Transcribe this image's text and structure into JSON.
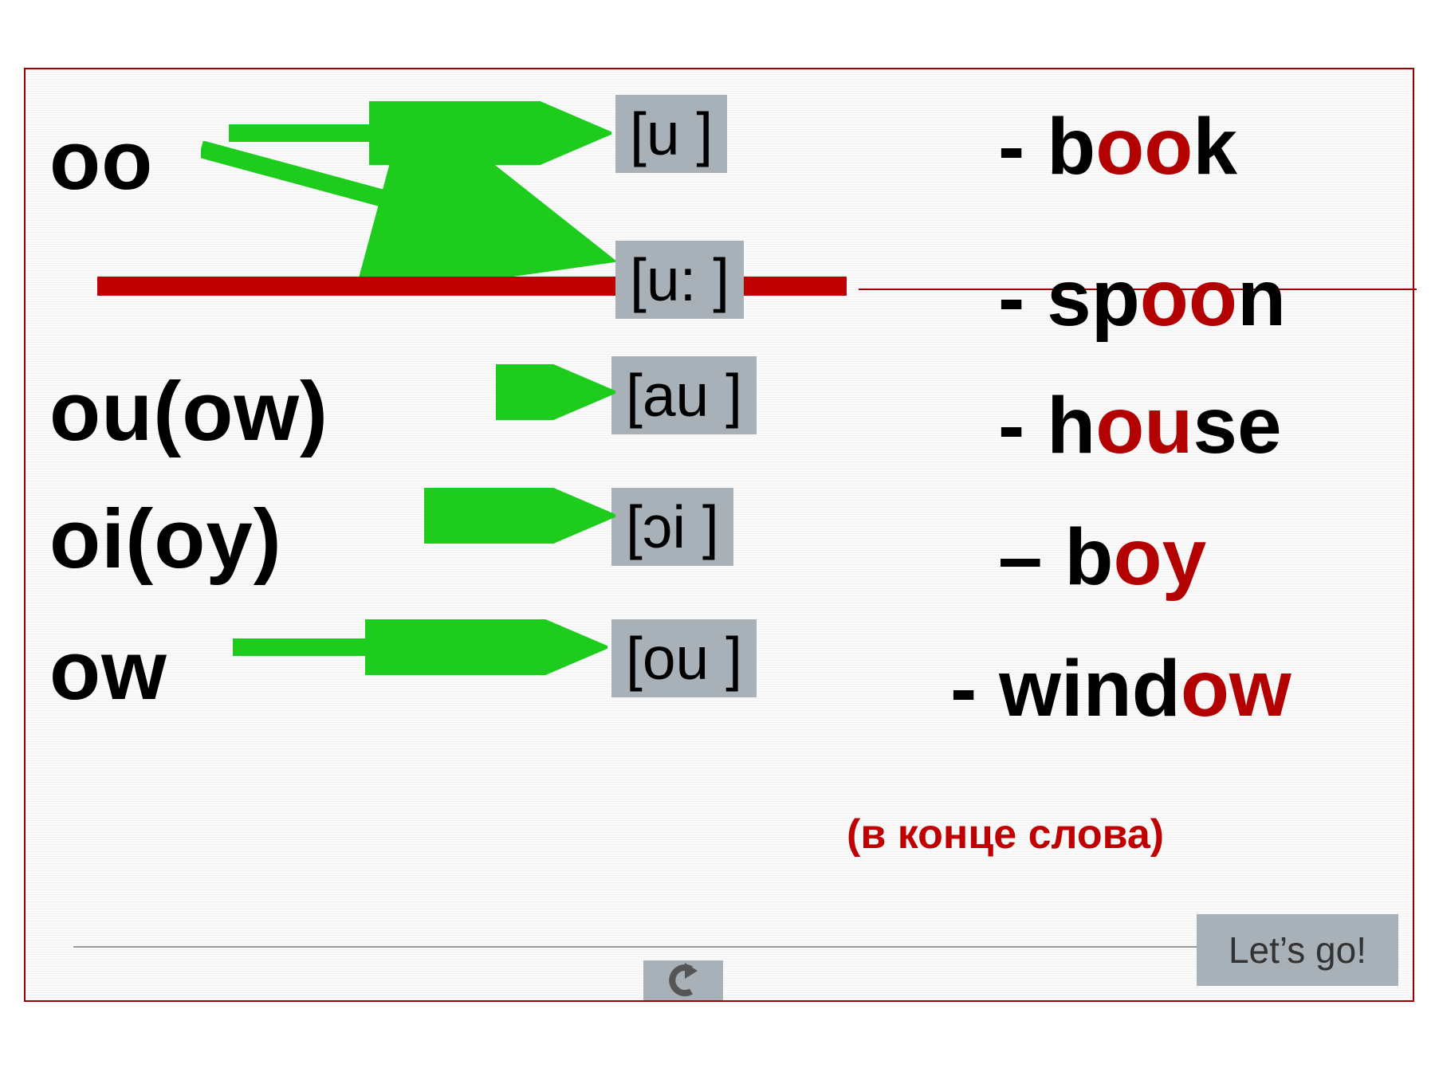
{
  "row1": {
    "letters": "oo",
    "phon_a": "[u ]",
    "phon_b": "[u: ]",
    "ex_a": {
      "dash": "- ",
      "pre": "b",
      "hl": "oo",
      "post": "k"
    },
    "ex_b": {
      "dash": "- ",
      "pre": "sp",
      "hl": "oo",
      "post": "n"
    }
  },
  "row2": {
    "letters": "ou(ow)",
    "phon": "[au ]",
    "ex": {
      "dash": "- ",
      "pre": "h",
      "hl": "ou",
      "post": "se"
    }
  },
  "row3": {
    "letters": "oi(oy)",
    "phon": "[ɔi ]",
    "ex": {
      "dash": "– ",
      "pre": "b",
      "hl": "oy",
      "post": ""
    }
  },
  "row4": {
    "letters": "ow",
    "phon": "[ou ]",
    "ex": {
      "dash": "- ",
      "pre": "wind",
      "hl": "ow",
      "post": ""
    }
  },
  "subnote": "(в конце слова)",
  "lets_go": "Let’s go!",
  "return_icon": "↻"
}
